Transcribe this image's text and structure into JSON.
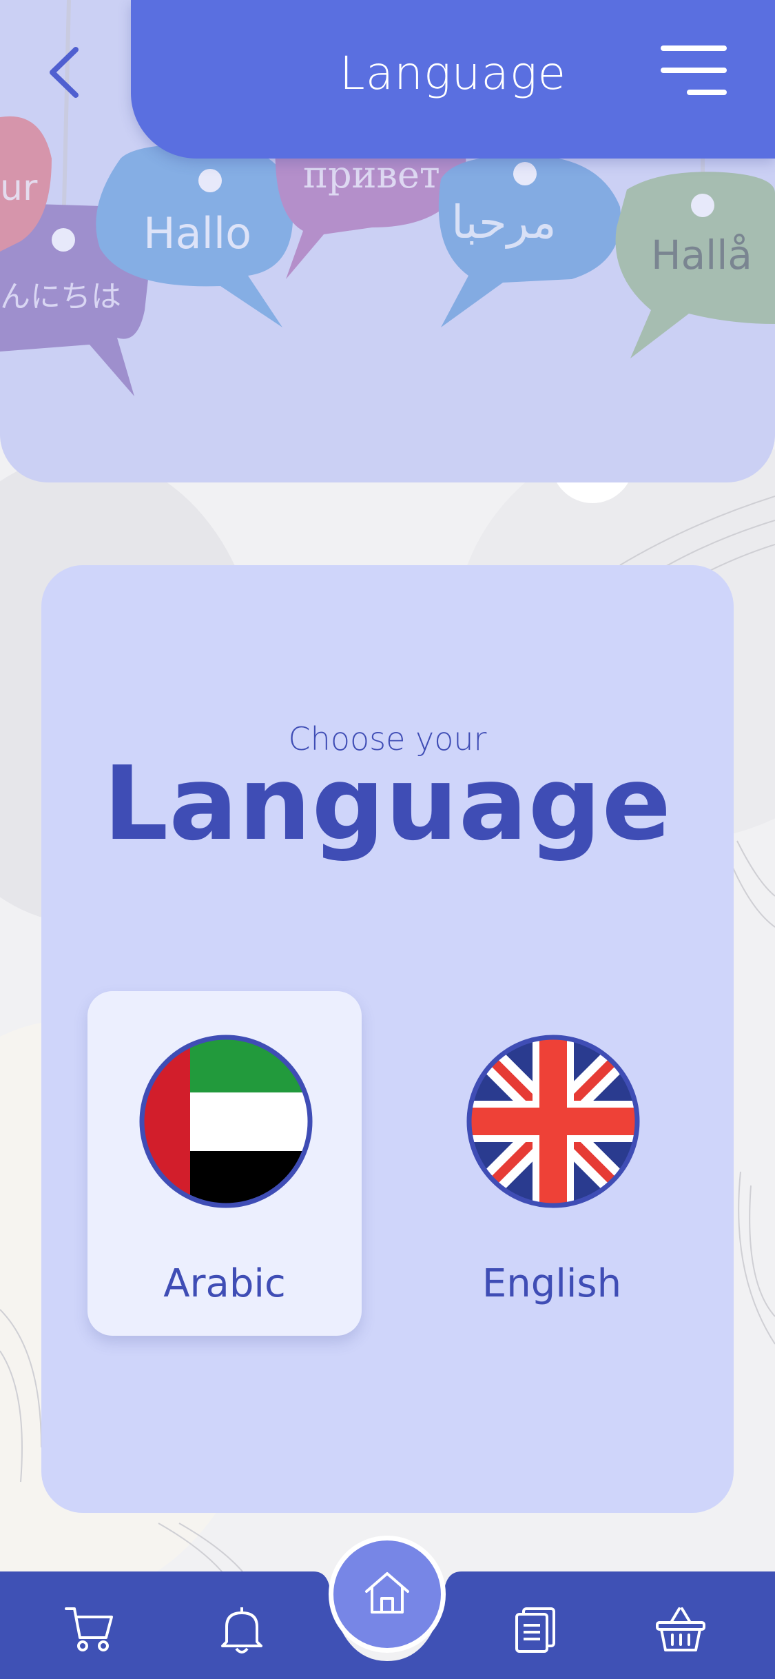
{
  "header": {
    "title": "Language",
    "back_icon": "chevron-left-icon",
    "menu_icon": "hamburger-menu-icon"
  },
  "hero": {
    "bubbles": [
      "our",
      "んにちは",
      "Hallo",
      "привет",
      "مرحبا",
      "Hallå"
    ]
  },
  "card": {
    "subtitle": "Choose your",
    "title": "Language",
    "options": [
      {
        "label": "Arabic",
        "flag": "uae-flag",
        "selected": true
      },
      {
        "label": "English",
        "flag": "uk-flag",
        "selected": false
      }
    ]
  },
  "bottom_nav": {
    "items": [
      "cart-icon",
      "bell-icon",
      "home-icon",
      "document-icon",
      "basket-icon"
    ],
    "active": "home-icon"
  },
  "colors": {
    "primary": "#5a6fe0",
    "accent_dark": "#3f4db5",
    "card_bg": "#cfd5fa",
    "nav_bg": "#3f51b5"
  }
}
